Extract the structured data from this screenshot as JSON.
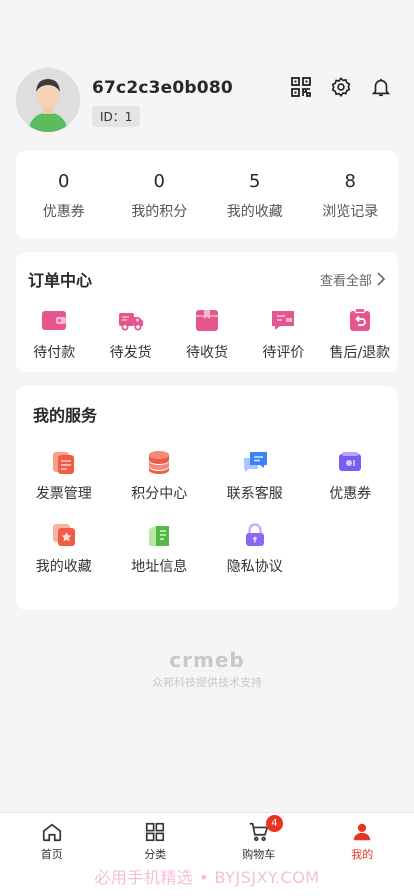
{
  "profile": {
    "username": "67c2c3e0b080",
    "id_text": "ID：1"
  },
  "header_icons": [
    "qrcode-icon",
    "settings-icon",
    "bell-icon"
  ],
  "stats": [
    {
      "value": "0",
      "label": "优惠券"
    },
    {
      "value": "0",
      "label": "我的积分"
    },
    {
      "value": "5",
      "label": "我的收藏"
    },
    {
      "value": "8",
      "label": "浏览记录"
    }
  ],
  "orders": {
    "title": "订单中心",
    "more": "查看全部",
    "items": [
      {
        "label": "待付款",
        "icon": "wallet-icon"
      },
      {
        "label": "待发货",
        "icon": "truck-icon"
      },
      {
        "label": "待收货",
        "icon": "package-icon"
      },
      {
        "label": "待评价",
        "icon": "review-icon"
      },
      {
        "label": "售后/退款",
        "icon": "refund-icon"
      }
    ],
    "accent": "#e5568e"
  },
  "services": {
    "title": "我的服务",
    "items": [
      {
        "label": "发票管理",
        "icon": "invoice-icon"
      },
      {
        "label": "积分中心",
        "icon": "points-icon"
      },
      {
        "label": "联系客服",
        "icon": "chat-icon"
      },
      {
        "label": "优惠券",
        "icon": "coupon-icon"
      },
      {
        "label": "我的收藏",
        "icon": "favorite-icon"
      },
      {
        "label": "地址信息",
        "icon": "address-icon"
      },
      {
        "label": "隐私协议",
        "icon": "lock-icon"
      }
    ]
  },
  "brand": {
    "logo": "crmeb",
    "sub": "众邦科技提供技术支持"
  },
  "tabbar": {
    "items": [
      {
        "label": "首页",
        "icon": "home-icon"
      },
      {
        "label": "分类",
        "icon": "grid-icon"
      },
      {
        "label": "购物车",
        "icon": "cart-icon",
        "badge": "4"
      },
      {
        "label": "我的",
        "icon": "user-icon",
        "active": true
      }
    ],
    "active_color": "#e93323"
  },
  "watermark": "必用手机精选 • BYJSJXY.COM"
}
